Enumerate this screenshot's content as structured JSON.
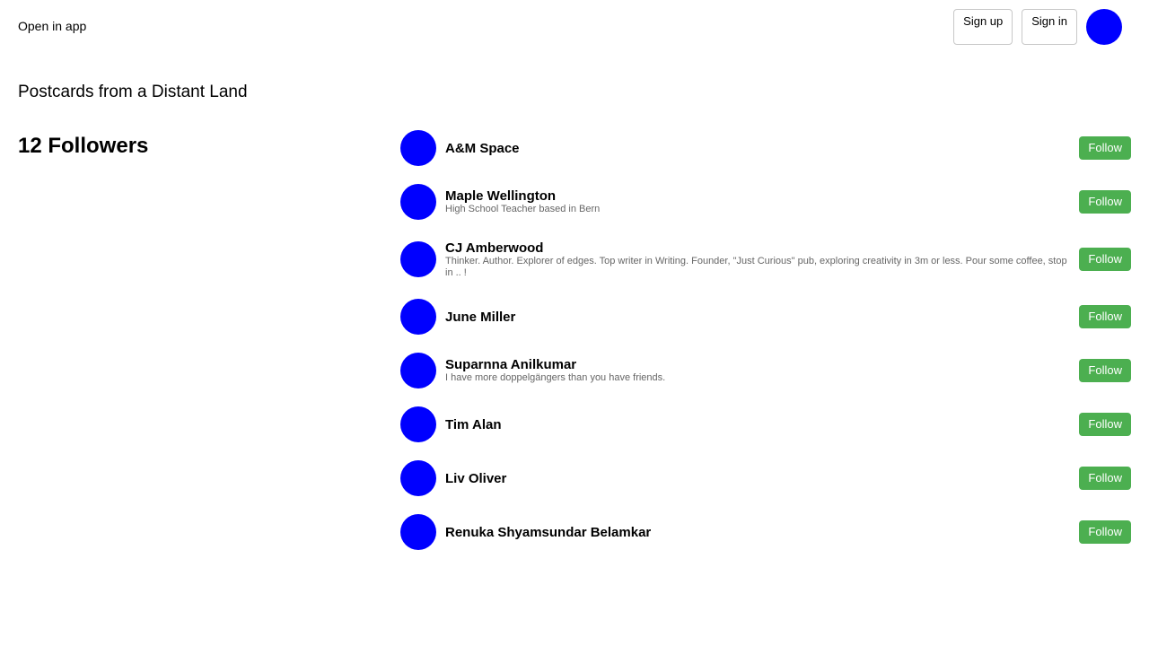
{
  "topbar": {
    "open_in_app": "Open in app",
    "sign_up": "Sign up",
    "sign_in": "Sign in",
    "avatar_color": "#0000ff"
  },
  "publication": {
    "title": "Postcards from a Distant Land"
  },
  "followers": {
    "heading": "12 Followers",
    "follow_label": "Follow",
    "follow_color": "#4caf50",
    "items": [
      {
        "name": "A&M Space",
        "bio": ""
      },
      {
        "name": "Maple Wellington",
        "bio": "High School Teacher based in Bern"
      },
      {
        "name": "CJ Amberwood",
        "bio": "Thinker. Author. Explorer of edges. Top writer in Writing. Founder, \"Just Curious\" pub, exploring creativity in 3m or less. Pour some coffee, stop in .. !"
      },
      {
        "name": "June Miller",
        "bio": ""
      },
      {
        "name": "Suparnna Anilkumar",
        "bio": "I have more doppelgängers than you have friends."
      },
      {
        "name": "Tim Alan",
        "bio": ""
      },
      {
        "name": "Liv Oliver",
        "bio": ""
      },
      {
        "name": "Renuka Shyamsundar Belamkar",
        "bio": ""
      }
    ]
  }
}
